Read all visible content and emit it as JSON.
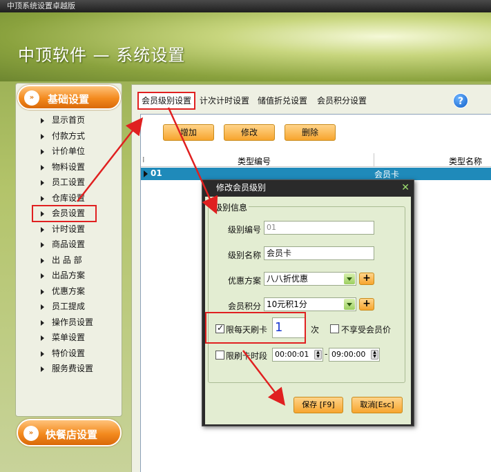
{
  "window": {
    "title": "中顶系统设置卓越版"
  },
  "header": {
    "title": "中顶软件 — 系统设置"
  },
  "sidebar": {
    "section_title": "基础设置",
    "items": [
      {
        "label": "显示首页"
      },
      {
        "label": "付款方式"
      },
      {
        "label": "计价单位"
      },
      {
        "label": "物料设置"
      },
      {
        "label": "员工设置"
      },
      {
        "label": "仓库设置"
      },
      {
        "label": "会员设置"
      },
      {
        "label": "计时设置"
      },
      {
        "label": "商品设置"
      },
      {
        "label": "出 品 部"
      },
      {
        "label": "出品方案"
      },
      {
        "label": "优惠方案"
      },
      {
        "label": "员工提成"
      },
      {
        "label": "操作员设置"
      },
      {
        "label": "菜单设置"
      },
      {
        "label": "特价设置"
      },
      {
        "label": "服务费设置"
      }
    ],
    "active_item": "会员设置",
    "footer_button": "快餐店设置"
  },
  "tabs": [
    {
      "label": "会员级别设置"
    },
    {
      "label": "计次计时设置"
    },
    {
      "label": "储值折兑设置"
    },
    {
      "label": "会员积分设置"
    }
  ],
  "toolbar": {
    "add": "增加",
    "edit": "修改",
    "delete": "删除"
  },
  "table": {
    "columns": [
      "类型编号",
      "类型名称"
    ],
    "rows": [
      {
        "code": "01",
        "name": "会员卡"
      }
    ]
  },
  "dialog": {
    "title": "修改会员级别",
    "group_title": "级别信息",
    "fields": {
      "level_code_label": "级别编号",
      "level_code_value": "01",
      "level_name_label": "级别名称",
      "level_name_value": "会员卡",
      "discount_label": "优惠方案",
      "discount_value": "八八折优惠",
      "points_label": "会员积分",
      "points_value": "10元积1分",
      "daily_limit_label": "限每天刷卡",
      "daily_limit_checked": true,
      "daily_limit_value": "1",
      "daily_limit_unit": "次",
      "no_member_price_label": "不享受会员价",
      "no_member_price_checked": false,
      "time_limit_label": "限刷卡时段",
      "time_limit_checked": false,
      "time_from": "00:00:01",
      "time_sep": "-",
      "time_to": "09:00:00"
    },
    "save": "保存 [F9]",
    "cancel": "取消[Esc]"
  },
  "colors": {
    "highlight": "#e02020",
    "row_selected": "#1f8aba",
    "accent_orange": "#f38a1e"
  }
}
